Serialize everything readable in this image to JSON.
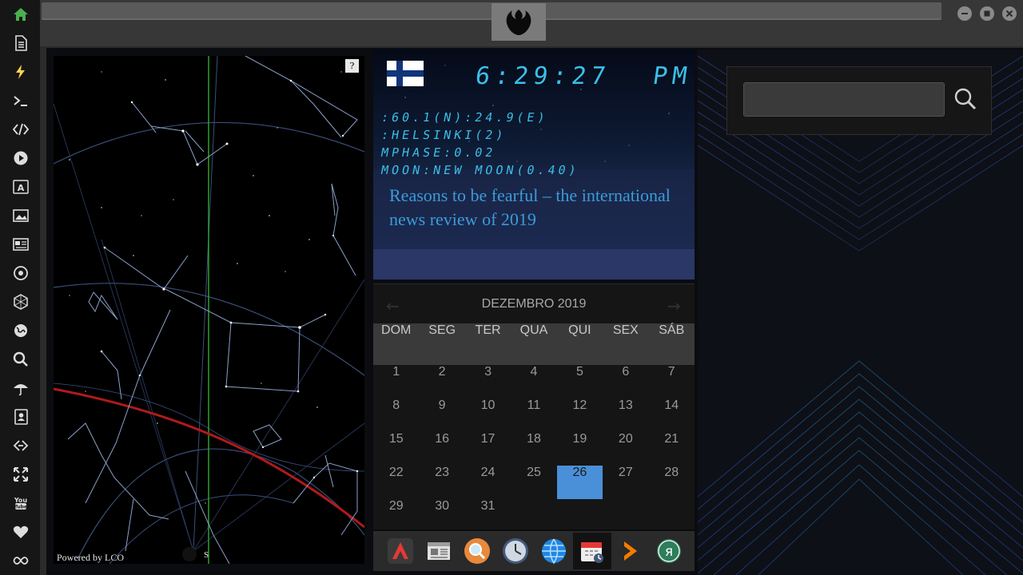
{
  "window": {
    "logo_icon": "rebel-alliance-logo",
    "buttons": [
      "minimize-icon",
      "maximize-icon",
      "close-icon"
    ]
  },
  "sidebar": {
    "items": [
      {
        "icon": "home-icon",
        "color": "#4caf50"
      },
      {
        "icon": "document-icon"
      },
      {
        "icon": "lightning-icon",
        "color": "#ffd54f"
      },
      {
        "icon": "terminal-icon"
      },
      {
        "icon": "code-icon"
      },
      {
        "icon": "play-icon"
      },
      {
        "icon": "translate-icon"
      },
      {
        "icon": "image-icon"
      },
      {
        "icon": "newspaper-icon"
      },
      {
        "icon": "rebel-icon"
      },
      {
        "icon": "hexagon-icon"
      },
      {
        "icon": "globe-icon"
      },
      {
        "icon": "search-icon"
      },
      {
        "icon": "umbrella-icon"
      },
      {
        "icon": "contact-icon"
      },
      {
        "icon": "link-icon"
      },
      {
        "icon": "expand-icon"
      },
      {
        "icon": "youtube-icon"
      },
      {
        "icon": "heart-icon"
      },
      {
        "icon": "infinity-icon"
      }
    ]
  },
  "skymap": {
    "help_label": "?",
    "powered_by": "Powered by LCO",
    "south_label": "S"
  },
  "clock": {
    "flag": "finland-flag",
    "time": "6:29:27",
    "ampm": "PM",
    "coords": ":60.1(N):24.9(E)",
    "location": ":HELSINKI(2)",
    "mphase": "MPHASE:0.02",
    "moon": "MOON:NEW MOON(0.40)",
    "news_headline": "Reasons to be fearful – the international news review of 2019"
  },
  "calendar": {
    "title": "DEZEMBRO 2019",
    "prev_icon": "arrow-left-icon",
    "next_icon": "arrow-right-icon",
    "weekdays": [
      "DOM",
      "SEG",
      "TER",
      "QUA",
      "QUI",
      "SEX",
      "SÁB"
    ],
    "weeks": [
      [
        "1",
        "2",
        "3",
        "4",
        "5",
        "6",
        "7"
      ],
      [
        "8",
        "9",
        "10",
        "11",
        "12",
        "13",
        "14"
      ],
      [
        "15",
        "16",
        "17",
        "18",
        "19",
        "20",
        "21"
      ],
      [
        "22",
        "23",
        "24",
        "25",
        "26",
        "27",
        "28"
      ],
      [
        "29",
        "30",
        "31",
        "",
        "",
        "",
        ""
      ]
    ],
    "today": "26",
    "accent": "#4a90d9"
  },
  "dock": {
    "apps": [
      {
        "icon": "arch-app-icon"
      },
      {
        "icon": "news-app-icon"
      },
      {
        "icon": "search-app-icon"
      },
      {
        "icon": "clock-app-icon"
      },
      {
        "icon": "globe-app-icon"
      },
      {
        "icon": "calendar-app-icon",
        "active": true
      },
      {
        "icon": "chevron-app-icon"
      },
      {
        "icon": "yandex-app-icon"
      }
    ]
  },
  "search": {
    "placeholder": "",
    "value": "",
    "button_icon": "search-icon"
  }
}
